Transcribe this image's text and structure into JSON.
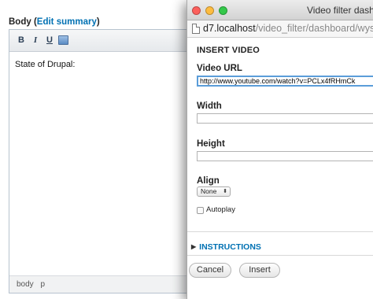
{
  "editor": {
    "label": "Body",
    "edit_summary_link": "Edit summary",
    "toolbar": {
      "bold": "B",
      "italic": "I",
      "underline": "U",
      "video_icon": "video-icon"
    },
    "content": "State of Drupal:",
    "status_path": [
      "body",
      "p"
    ]
  },
  "popup": {
    "window_title": "Video filter dashboard",
    "url_host": "d7.localhost",
    "url_path": "/video_filter/dashboard/wysiwyg_ckeditor",
    "form_title": "INSERT VIDEO",
    "video_url": {
      "label": "Video URL",
      "value": "http://www.youtube.com/watch?v=PCLx4fRHmCk"
    },
    "width": {
      "label": "Width",
      "value": ""
    },
    "height": {
      "label": "Height",
      "value": ""
    },
    "align": {
      "label": "Align",
      "selected": "None"
    },
    "autoplay": {
      "label": "Autoplay",
      "checked": false
    },
    "instructions_label": "INSTRUCTIONS",
    "buttons": {
      "cancel": "Cancel",
      "insert": "Insert"
    }
  }
}
